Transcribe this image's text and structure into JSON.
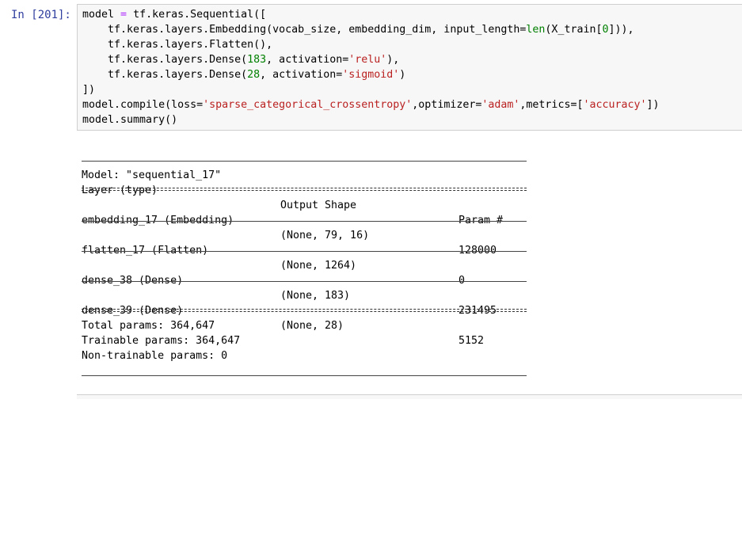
{
  "cell": {
    "prompt": "In [201]:",
    "code": {
      "l1": [
        "model",
        " = ",
        "tf.keras.Sequential([",
        "",
        ""
      ],
      "l2a": "    tf.keras.layers.Embedding(vocab_size, embedding_dim, input_length=",
      "l2b": "len",
      "l2c": "(X_train[",
      "l2d": "0",
      "l2e": "])),",
      "l3": "    tf.keras.layers.Flatten(),",
      "l4a": "    tf.keras.layers.Dense(",
      "l4b": "183",
      "l4c": ", activation=",
      "l4d": "'relu'",
      "l4e": "),",
      "l5a": "    tf.keras.layers.Dense(",
      "l5b": "28",
      "l5c": ", activation=",
      "l5d": "'sigmoid'",
      "l5e": ")",
      "l6": "])",
      "l7a": "model.compile(loss=",
      "l7b": "'sparse_categorical_crossentropy'",
      "l7c": ",optimizer=",
      "l7d": "'adam'",
      "l7e": ",metrics=[",
      "l7f": "'accuracy'",
      "l7g": "])",
      "l8": "model.summary()"
    }
  },
  "summary": {
    "model_line": "Model: \"sequential_17\"",
    "headers": {
      "layer": "Layer (type)",
      "shape": "Output Shape",
      "params": "Param #"
    },
    "rows": [
      {
        "layer": "embedding_17 (Embedding)",
        "shape": "(None, 79, 16)",
        "params": "128000"
      },
      {
        "layer": "flatten_17 (Flatten)",
        "shape": "(None, 1264)",
        "params": "0"
      },
      {
        "layer": "dense_38 (Dense)",
        "shape": "(None, 183)",
        "params": "231495"
      },
      {
        "layer": "dense_39 (Dense)",
        "shape": "(None, 28)",
        "params": "5152"
      }
    ],
    "total": "Total params: 364,647",
    "trainable": "Trainable params: 364,647",
    "non_trainable": "Non-trainable params: 0"
  }
}
